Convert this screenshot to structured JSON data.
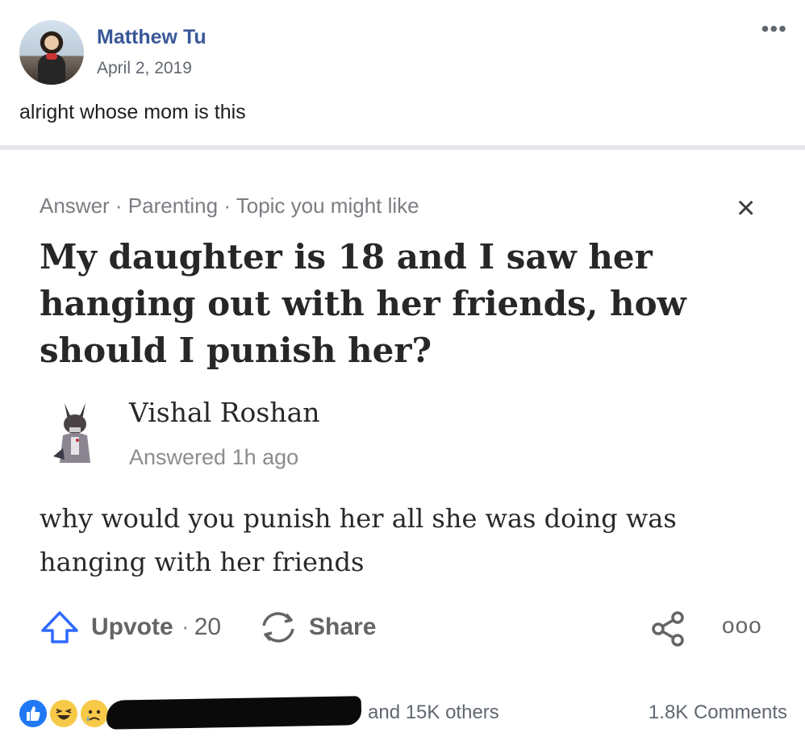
{
  "post": {
    "author": "Matthew Tu",
    "date": "April 2, 2019",
    "text": "alright whose mom is this",
    "more_icon": "ellipsis-icon"
  },
  "card": {
    "meta": "Answer · Parenting · Topic you might like",
    "close_label": "×",
    "question": "My daughter is 18 and I saw her hanging out with her friends, how should I punish her?",
    "answerer": "Vishal Roshan",
    "answered_time": "Answered 1h ago",
    "answer_text": "why would you punish her all she was doing was hanging with her friends",
    "upvote_label": "Upvote",
    "vote_separator": "·",
    "vote_count": "20",
    "share_label": "Share",
    "more_label": "ooo"
  },
  "footer": {
    "others": "and 15K others",
    "comments": "1.8K Comments"
  },
  "colors": {
    "link_blue": "#385898",
    "upvote_blue": "#2e69ff",
    "like_blue": "#2078f4",
    "reaction_yellow": "#f7c948"
  }
}
